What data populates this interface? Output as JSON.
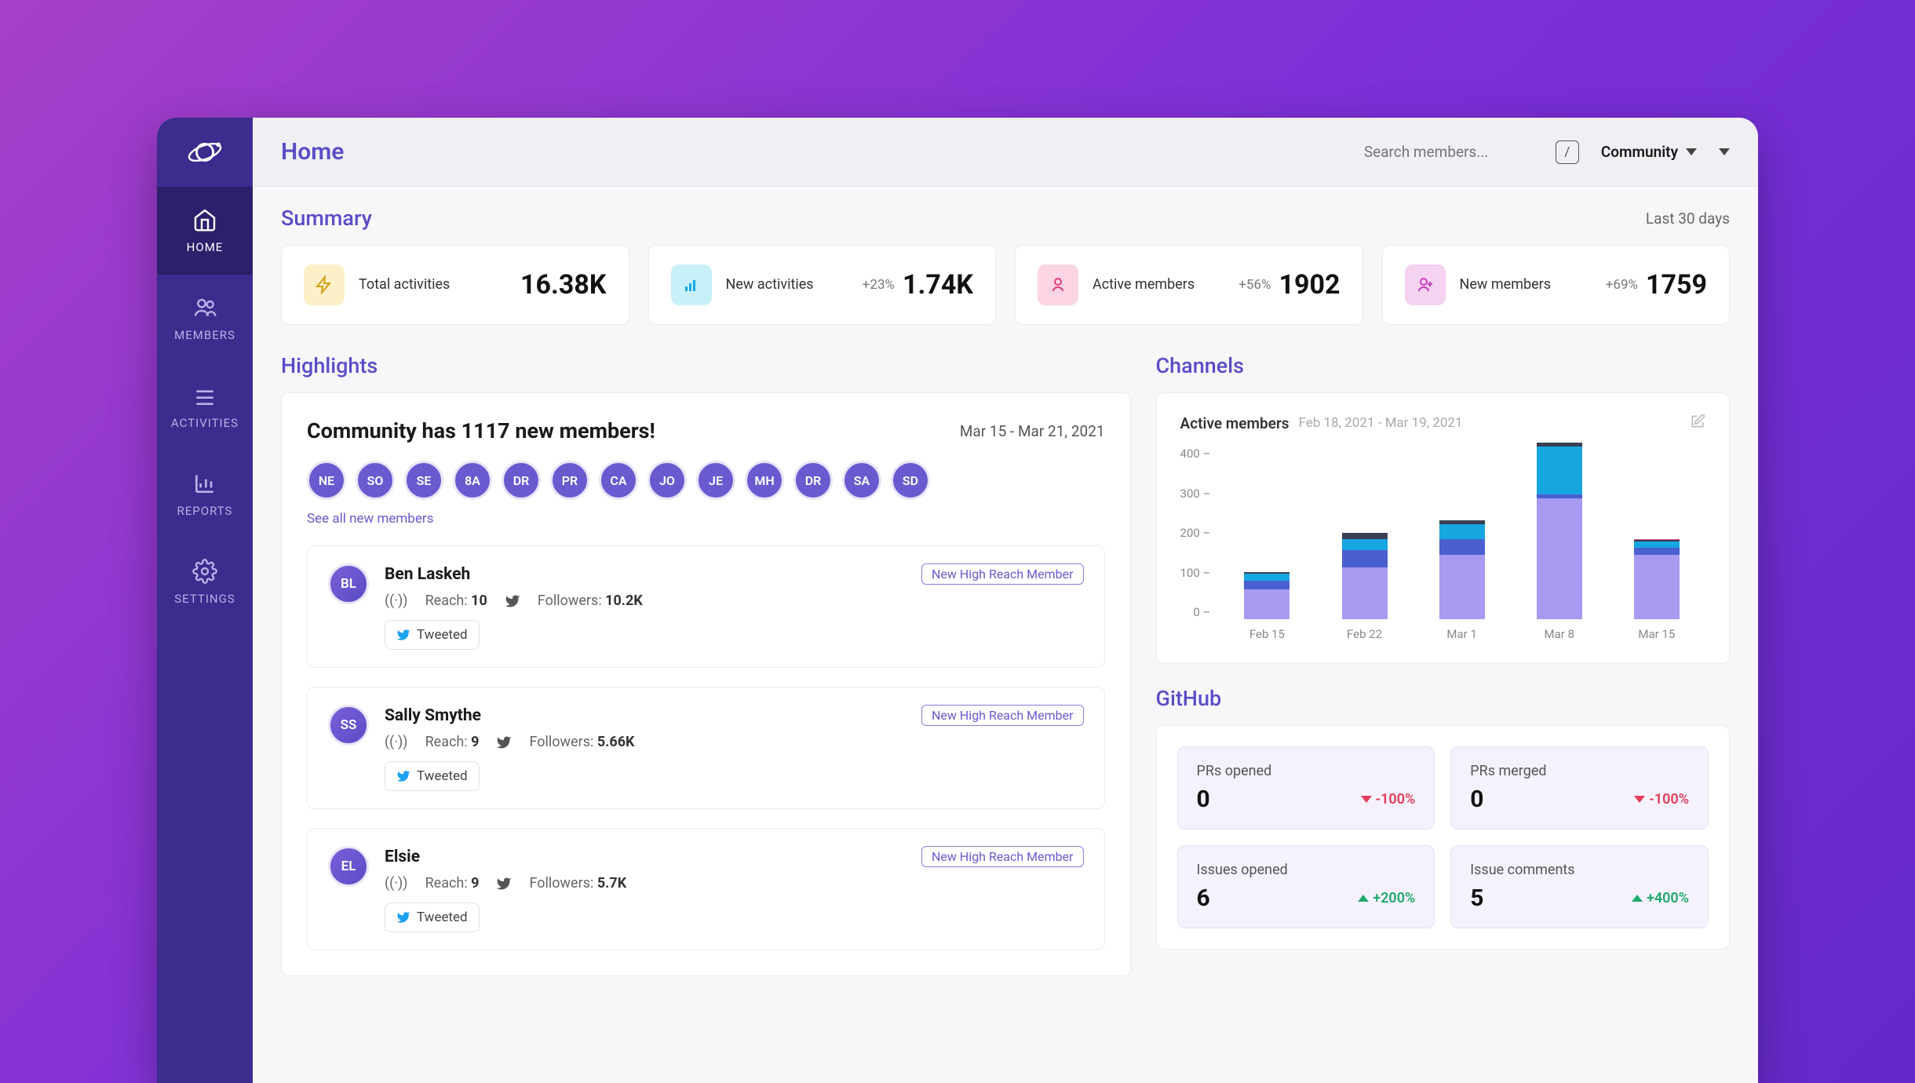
{
  "page_title": "Home",
  "search_placeholder": "Search members...",
  "kbd_hint": "/",
  "workspace_label": "Community",
  "sidebar": {
    "items": [
      {
        "label": "HOME",
        "icon": "home-icon"
      },
      {
        "label": "MEMBERS",
        "icon": "members-icon"
      },
      {
        "label": "ACTIVITIES",
        "icon": "activities-icon"
      },
      {
        "label": "REPORTS",
        "icon": "reports-icon"
      },
      {
        "label": "SETTINGS",
        "icon": "settings-icon"
      }
    ]
  },
  "summary": {
    "title": "Summary",
    "range": "Last 30 days",
    "cards": [
      {
        "label": "Total activities",
        "value": "16.38K",
        "delta": ""
      },
      {
        "label": "New activities",
        "value": "1.74K",
        "delta": "+23%"
      },
      {
        "label": "Active members",
        "value": "1902",
        "delta": "+56%"
      },
      {
        "label": "New members",
        "value": "1759",
        "delta": "+69%"
      }
    ]
  },
  "highlights": {
    "title": "Highlights",
    "headline": "Community has 1117 new members!",
    "date_range": "Mar 15 - Mar 21, 2021",
    "avatar_initials": [
      "NE",
      "SO",
      "SE",
      "8A",
      "DR",
      "PR",
      "CA",
      "JO",
      "JE",
      "MH",
      "DR",
      "SA",
      "SD"
    ],
    "see_all": "See all new members",
    "members": [
      {
        "initials": "BL",
        "name": "Ben Laskeh",
        "reach": "10",
        "followers": "10.2K",
        "badge": "New High Reach Member",
        "action": "Tweeted"
      },
      {
        "initials": "SS",
        "name": "Sally Smythe",
        "reach": "9",
        "followers": "5.66K",
        "badge": "New High Reach Member",
        "action": "Tweeted"
      },
      {
        "initials": "EL",
        "name": "Elsie",
        "reach": "9",
        "followers": "5.7K",
        "badge": "New High Reach Member",
        "action": "Tweeted"
      }
    ],
    "reach_label": "Reach:",
    "followers_label": "Followers:"
  },
  "channels": {
    "title": "Channels",
    "chart_title": "Active members",
    "chart_sub": "Feb 18, 2021 - Mar 19, 2021"
  },
  "chart_data": {
    "type": "bar",
    "title": "Active members",
    "xlabel": "",
    "ylabel": "",
    "ylim": [
      0,
      400
    ],
    "yticks": [
      0,
      100,
      200,
      300,
      400
    ],
    "categories": [
      "Feb 15",
      "Feb 22",
      "Mar 1",
      "Mar 8",
      "Mar 15"
    ],
    "series": [
      {
        "name": "segment-a",
        "color": "#a79af0",
        "values": [
          70,
          120,
          150,
          280,
          150
        ]
      },
      {
        "name": "segment-b",
        "color": "#4a5fd0",
        "values": [
          20,
          40,
          35,
          10,
          15
        ]
      },
      {
        "name": "segment-c",
        "color": "#17a7e0",
        "values": [
          15,
          25,
          35,
          110,
          15
        ]
      },
      {
        "name": "segment-d",
        "color": "#3a3f55",
        "values": [
          5,
          15,
          10,
          10,
          3
        ]
      },
      {
        "name": "segment-e",
        "color": "#d94a8c",
        "values": [
          0,
          0,
          0,
          0,
          2
        ]
      }
    ]
  },
  "github": {
    "title": "GitHub",
    "cards": [
      {
        "label": "PRs opened",
        "value": "0",
        "delta": "-100%",
        "dir": "neg"
      },
      {
        "label": "PRs merged",
        "value": "0",
        "delta": "-100%",
        "dir": "neg"
      },
      {
        "label": "Issues opened",
        "value": "6",
        "delta": "+200%",
        "dir": "pos"
      },
      {
        "label": "Issue comments",
        "value": "5",
        "delta": "+400%",
        "dir": "pos"
      }
    ]
  }
}
